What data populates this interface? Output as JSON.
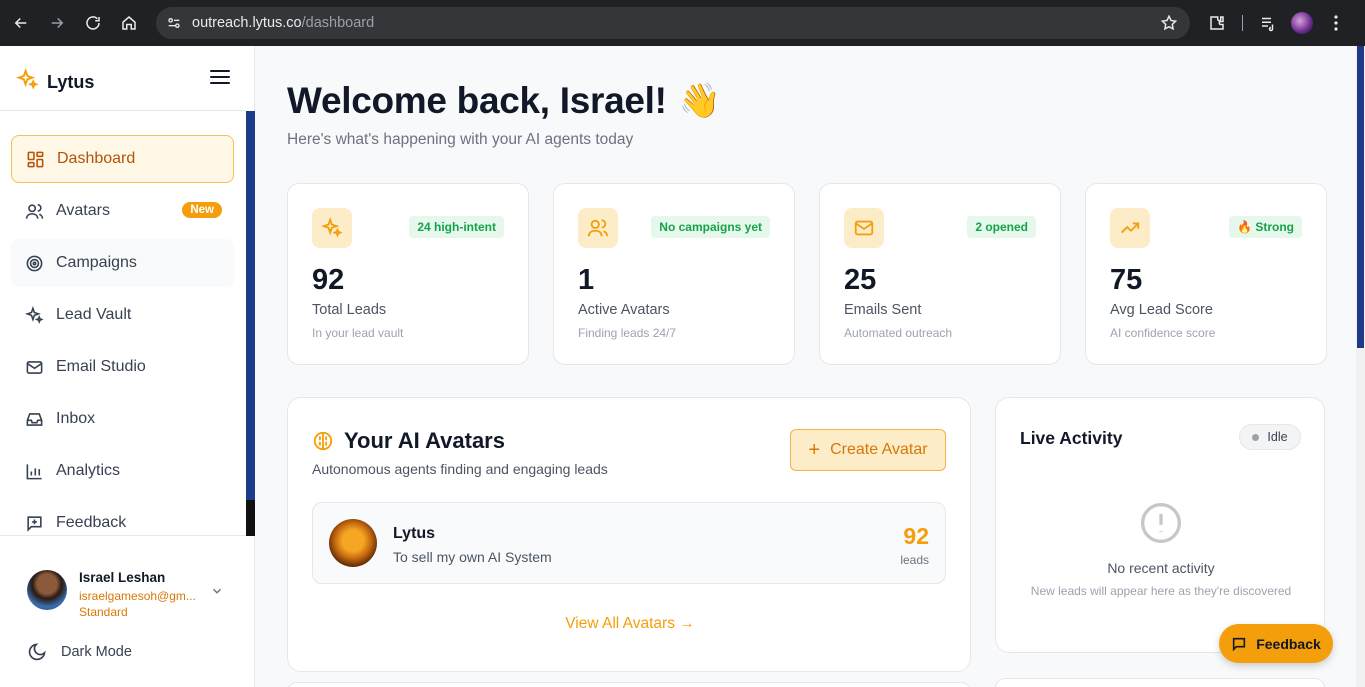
{
  "browser": {
    "url_domain": "outreach.lytus.co",
    "url_path": "/dashboard"
  },
  "sidebar": {
    "brand": "Lytus",
    "items": [
      {
        "label": "Dashboard",
        "icon": "dashboard-icon",
        "active": true
      },
      {
        "label": "Avatars",
        "icon": "users-icon",
        "badge": "New"
      },
      {
        "label": "Campaigns",
        "icon": "target-icon"
      },
      {
        "label": "Lead Vault",
        "icon": "sparkles-icon"
      },
      {
        "label": "Email Studio",
        "icon": "mail-icon"
      },
      {
        "label": "Inbox",
        "icon": "inbox-icon"
      },
      {
        "label": "Analytics",
        "icon": "bar-chart-icon"
      },
      {
        "label": "Feedback",
        "icon": "message-plus-icon"
      }
    ],
    "user": {
      "name": "Israel Leshan",
      "email": "israelgamesoh@gm...",
      "plan": "Standard"
    },
    "dark_mode_label": "Dark Mode"
  },
  "header": {
    "title": "Welcome back, Israel!",
    "emoji": "👋",
    "subtitle": "Here's what's happening with your AI agents today"
  },
  "stats": [
    {
      "icon": "sparkles-icon",
      "badge": "24 high-intent",
      "value": "92",
      "label": "Total Leads",
      "sub": "In your lead vault"
    },
    {
      "icon": "users-icon",
      "badge": "No campaigns yet",
      "value": "1",
      "label": "Active Avatars",
      "sub": "Finding leads 24/7"
    },
    {
      "icon": "mail-icon",
      "badge": "2 opened",
      "value": "25",
      "label": "Emails Sent",
      "sub": "Automated outreach"
    },
    {
      "icon": "trending-up-icon",
      "badge": "🔥 Strong",
      "value": "75",
      "label": "Avg Lead Score",
      "sub": "AI confidence score"
    }
  ],
  "avatars_section": {
    "title": "Your AI Avatars",
    "subtitle": "Autonomous agents finding and engaging leads",
    "create_label": "Create Avatar",
    "avatar": {
      "name": "Lytus",
      "description": "To sell my own AI System",
      "count": "92",
      "count_label": "leads"
    },
    "view_all": "View All Avatars →"
  },
  "live_activity": {
    "title": "Live Activity",
    "status": "Idle",
    "empty_title": "No recent activity",
    "empty_sub": "New leads will appear here as they're discovered"
  },
  "feedback_button": "Feedback",
  "colors": {
    "accent": "#f59e0b",
    "accent_dark": "#d97706",
    "success": "#16a34a",
    "scroll_accent": "#1e3a8a"
  }
}
